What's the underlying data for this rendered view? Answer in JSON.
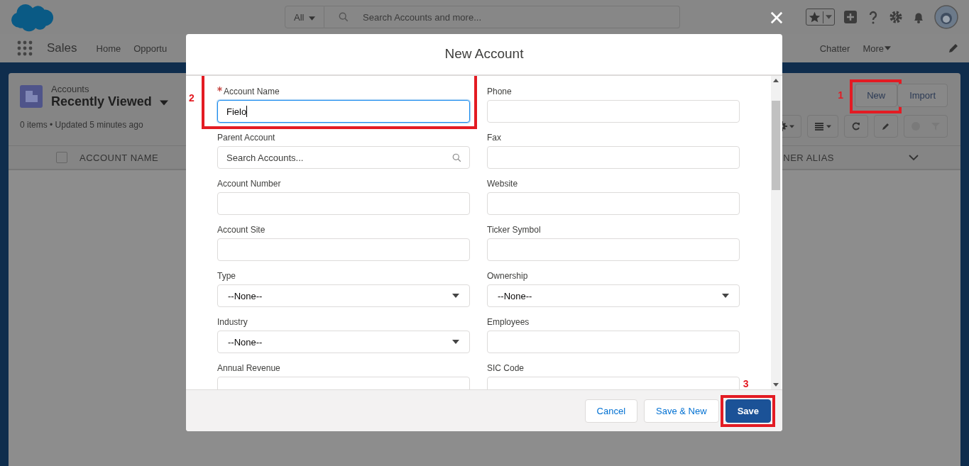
{
  "header": {
    "search_scope": "All",
    "search_placeholder": "Search Accounts and more..."
  },
  "nav": {
    "app_name": "Sales",
    "items_left": [
      "Home",
      "Opportu"
    ],
    "items_right": [
      "Chatter",
      "More"
    ]
  },
  "list_view": {
    "object": "Accounts",
    "view_name": "Recently Viewed",
    "status": "0 items • Updated 5 minutes ago",
    "buttons": [
      {
        "label": "New",
        "callout": "1"
      },
      {
        "label": "Import"
      }
    ],
    "select_all_checked": false,
    "columns": [
      "ACCOUNT NAME",
      "NER ALIAS"
    ]
  },
  "modal": {
    "title": "New Account",
    "left_fields": [
      {
        "kind": "text",
        "label": "Account Name",
        "required": true,
        "value": "Fielo",
        "focused": true,
        "callout": "2"
      },
      {
        "kind": "lookup",
        "label": "Parent Account",
        "placeholder": "Search Accounts..."
      },
      {
        "kind": "text",
        "label": "Account Number"
      },
      {
        "kind": "text",
        "label": "Account Site"
      },
      {
        "kind": "select",
        "label": "Type",
        "value": "--None--"
      },
      {
        "kind": "select",
        "label": "Industry",
        "value": "--None--"
      },
      {
        "kind": "text",
        "label": "Annual Revenue"
      }
    ],
    "right_fields": [
      {
        "kind": "text",
        "label": "Phone"
      },
      {
        "kind": "text",
        "label": "Fax"
      },
      {
        "kind": "text",
        "label": "Website"
      },
      {
        "kind": "text",
        "label": "Ticker Symbol"
      },
      {
        "kind": "select",
        "label": "Ownership",
        "value": "--None--"
      },
      {
        "kind": "text",
        "label": "Employees"
      },
      {
        "kind": "text",
        "label": "SIC Code"
      }
    ],
    "buttons": [
      {
        "kind": "neutral",
        "label": "Cancel"
      },
      {
        "kind": "neutral",
        "label": "Save & New"
      },
      {
        "kind": "brand",
        "label": "Save",
        "callout": "3"
      }
    ]
  }
}
